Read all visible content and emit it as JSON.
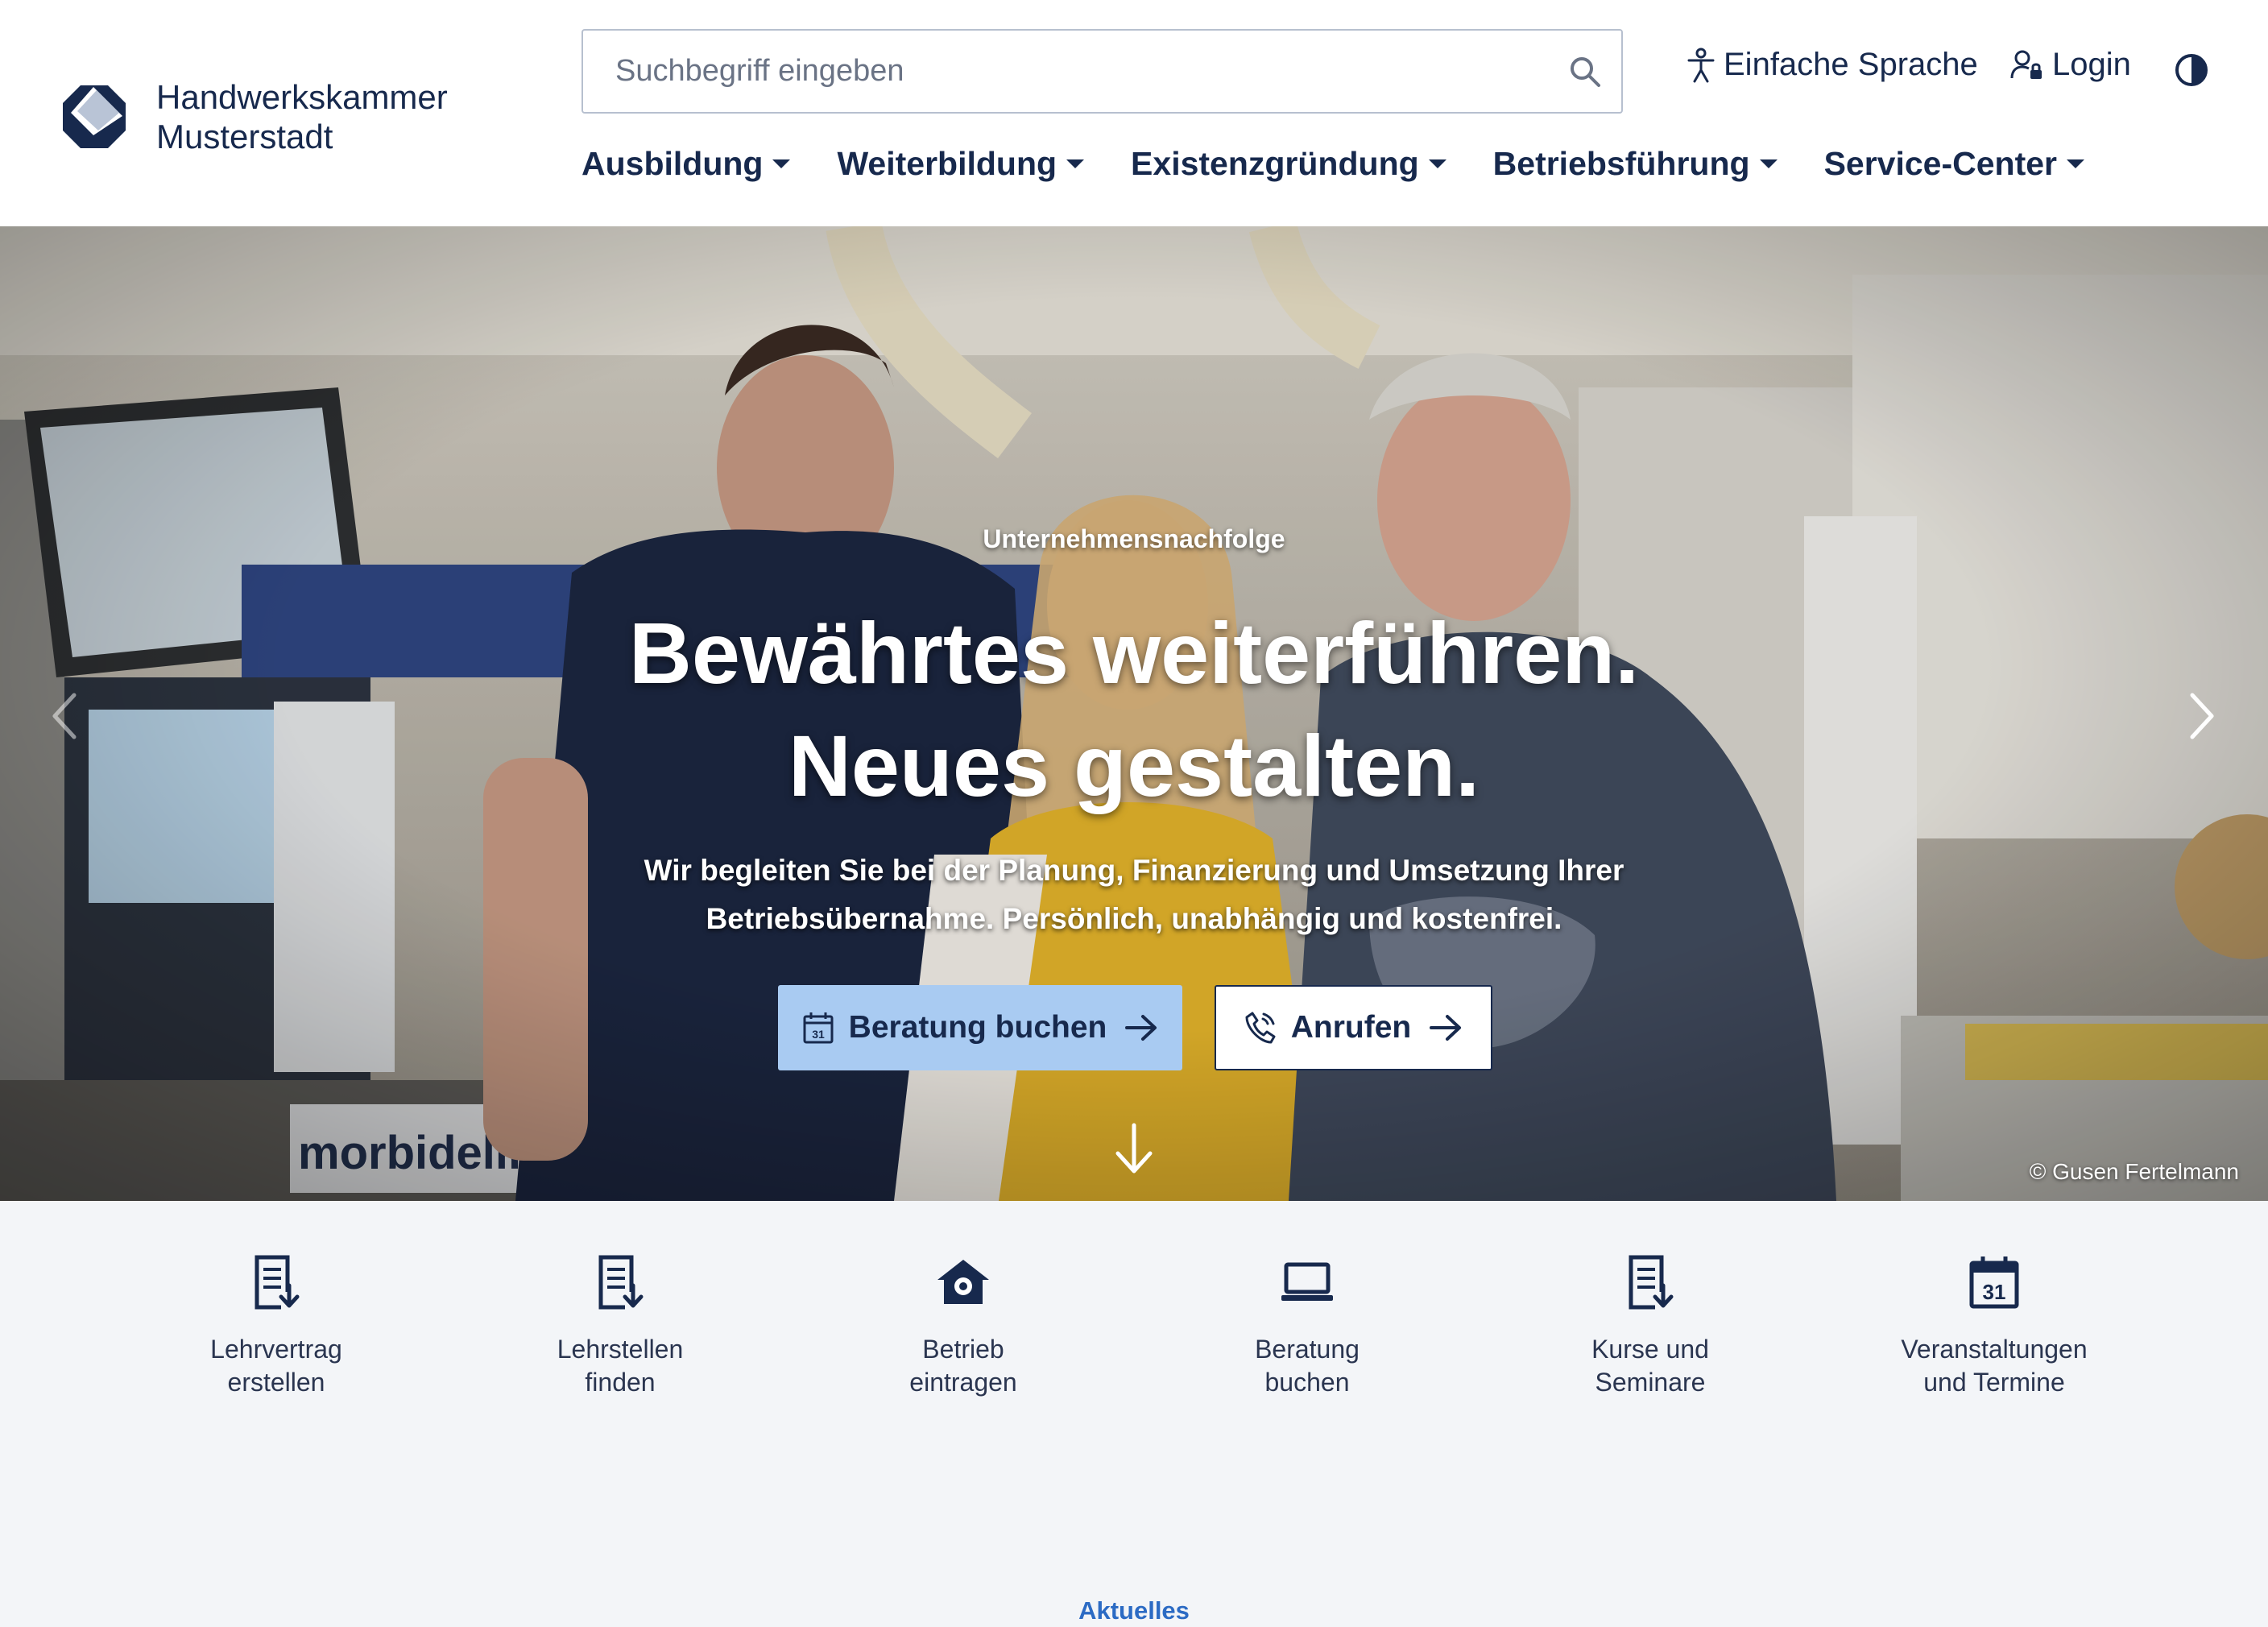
{
  "brand": {
    "name_line1": "Handwerkskammer",
    "name_line2": "Musterstadt"
  },
  "search": {
    "placeholder": "Suchbegriff eingeben"
  },
  "utility": {
    "simple_language": "Einfache Sprache",
    "login": "Login"
  },
  "nav": {
    "items": [
      {
        "label": "Ausbildung"
      },
      {
        "label": "Weiterbildung"
      },
      {
        "label": "Existenzgründung"
      },
      {
        "label": "Betriebsführung"
      },
      {
        "label": "Service-Center"
      }
    ]
  },
  "hero": {
    "kicker": "Unternehmensnachfolge",
    "title_line1": "Bewährtes weiterführen.",
    "title_line2": "Neues gestalten.",
    "text_line1": "Wir begleiten Sie bei der Planung, Finanzierung und Umsetzung Ihrer",
    "text_line2": "Betriebsübernahme. Persönlich, unabhängig und kostenfrei.",
    "primary_button": "Beratung buchen",
    "secondary_button": "Anrufen",
    "calendar_day": "31",
    "credit": "© Gusen Fertelmann"
  },
  "quick_links": [
    {
      "line1": "Lehrvertrag",
      "line2": "erstellen",
      "icon": "document-icon"
    },
    {
      "line1": "Lehrstellen",
      "line2": "finden",
      "icon": "document-icon"
    },
    {
      "line1": "Betrieb",
      "line2": "eintragen",
      "icon": "home-location-icon"
    },
    {
      "line1": "Beratung",
      "line2": "buchen",
      "icon": "laptop-icon"
    },
    {
      "line1": "Kurse und",
      "line2": "Seminare",
      "icon": "document-icon"
    },
    {
      "line1": "Veranstaltungen",
      "line2": "und Termine",
      "icon": "calendar-icon"
    }
  ],
  "calendar_day": "31",
  "section": {
    "label": "Aktuelles"
  },
  "colors": {
    "navy": "#17294d",
    "primary_button": "#a9cbf2",
    "link_blue": "#2c6bc4",
    "background": "#f3f5f8"
  }
}
